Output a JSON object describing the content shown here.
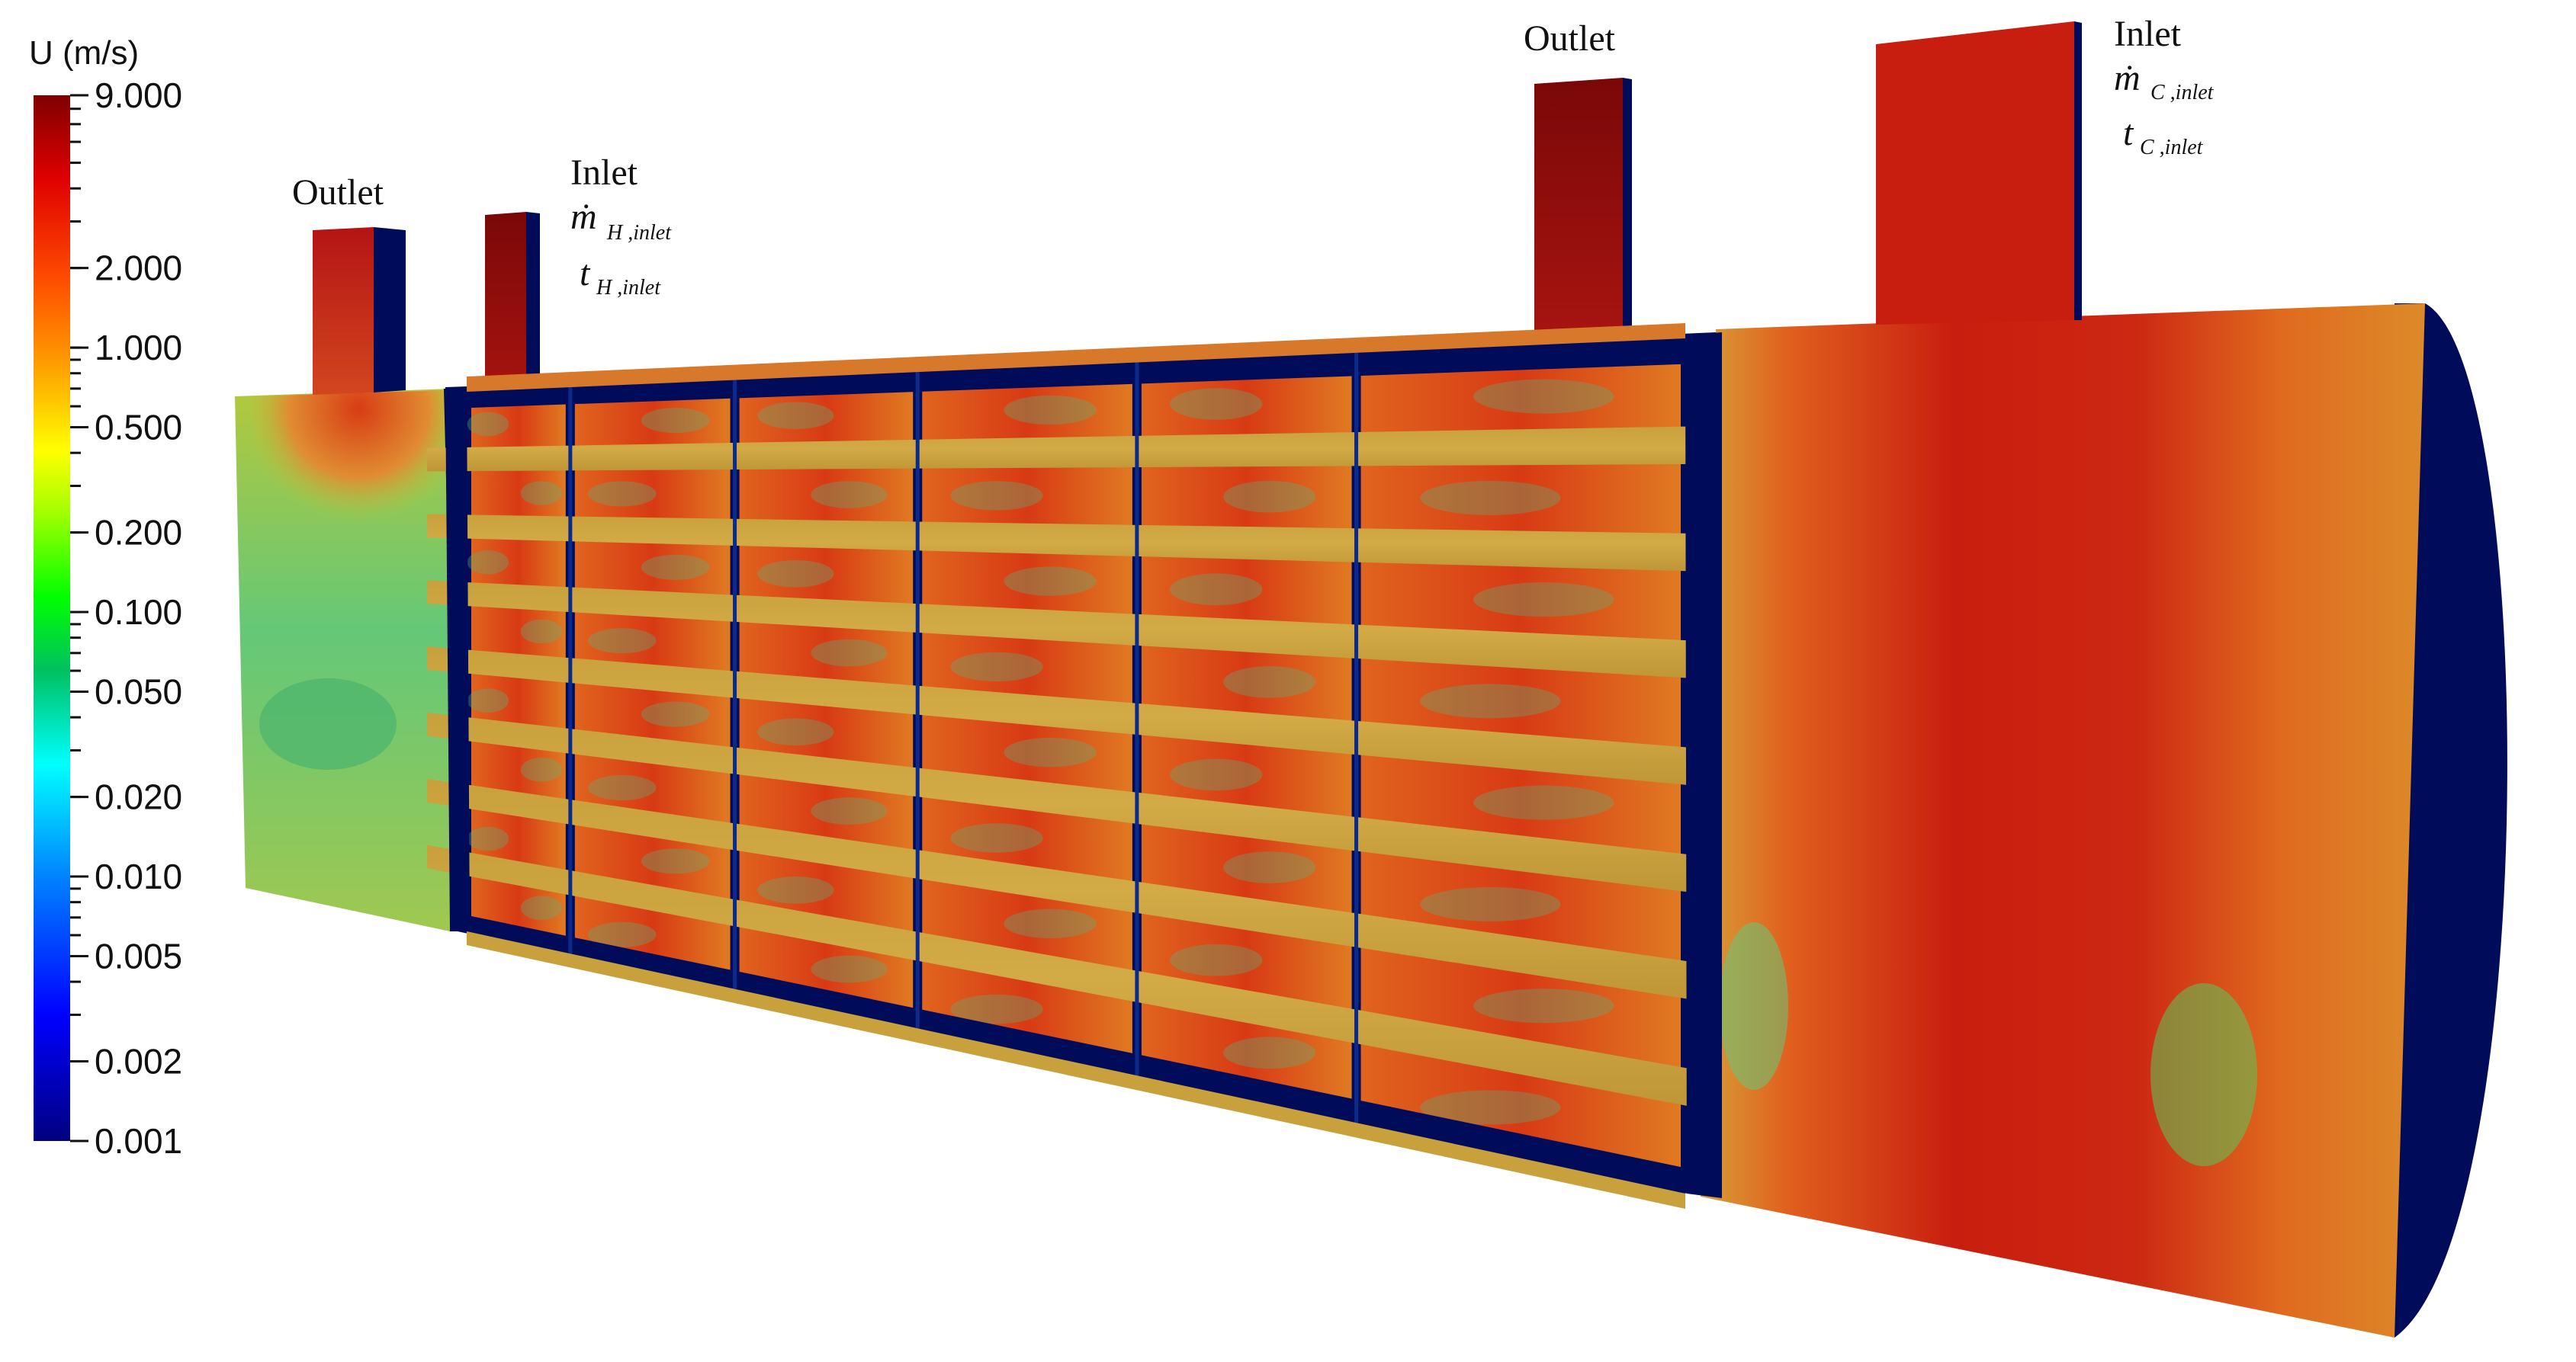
{
  "colorbar": {
    "title": "U (m/s)",
    "scale": "log",
    "min": 0.001,
    "max": 9.0,
    "tick_labels": [
      "9.000",
      "2.000",
      "1.000",
      "0.500",
      "0.200",
      "0.100",
      "0.050",
      "0.020",
      "0.010",
      "0.005",
      "0.002",
      "0.001"
    ],
    "tick_values": [
      9.0,
      2.0,
      1.0,
      0.5,
      0.2,
      0.1,
      0.05,
      0.02,
      0.01,
      0.005,
      0.002,
      0.001
    ],
    "colors": [
      "#00007f",
      "#0000ff",
      "#0080ff",
      "#00ffff",
      "#00c060",
      "#00ff00",
      "#a0ff00",
      "#ffff00",
      "#ffa000",
      "#ff5000",
      "#e00000",
      "#800000"
    ]
  },
  "annotations": {
    "hot_outlet": "Outlet",
    "hot_inlet": "Inlet",
    "hot_mass": {
      "symbol": "ṁ",
      "subscript": "H ,inlet"
    },
    "hot_temp": {
      "symbol": "t",
      "subscript": "H ,inlet"
    },
    "cold_outlet": "Outlet",
    "cold_inlet": "Inlet",
    "cold_mass": {
      "symbol": "ṁ",
      "subscript": "C ,inlet"
    },
    "cold_temp": {
      "symbol": "t",
      "subscript": "C ,inlet"
    }
  },
  "palette": {
    "deep_blue": "#000c5a",
    "dark_red": "#8a0a0a",
    "red": "#c81e0f",
    "orange_red": "#e04a14",
    "orange": "#e0781e",
    "olive": "#c8a03c",
    "yellow_green": "#b4c83c",
    "green": "#5ac85a",
    "teal": "#3cb4a0"
  }
}
